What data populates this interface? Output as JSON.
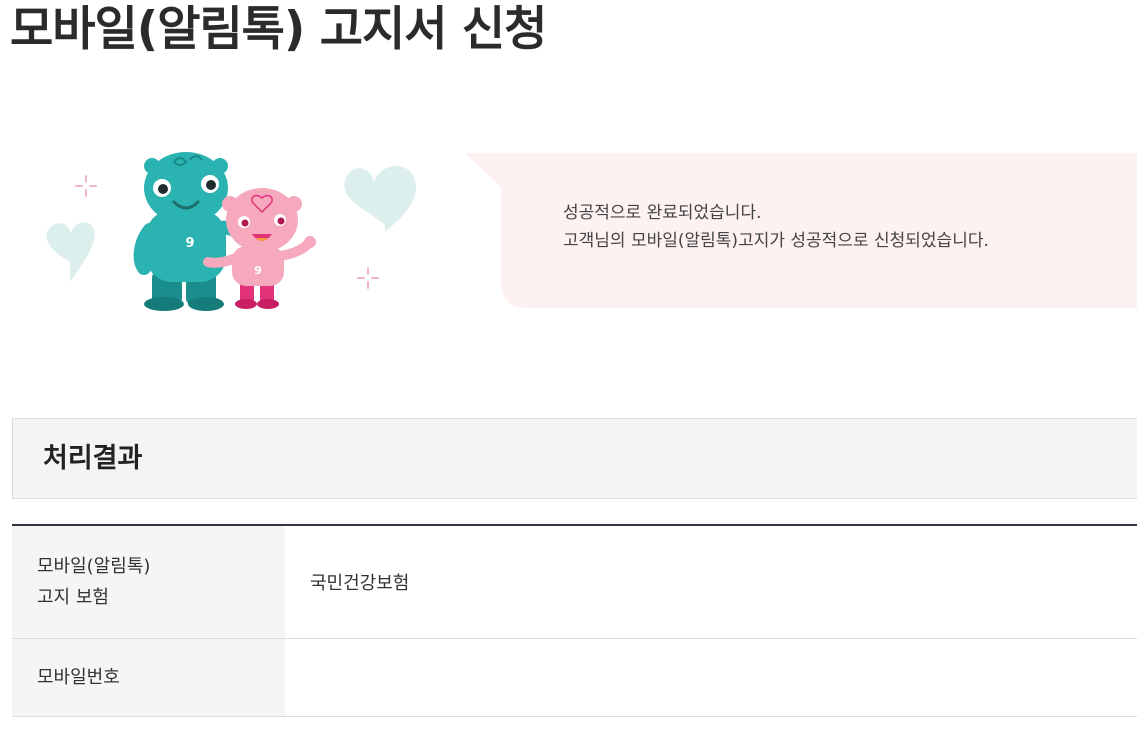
{
  "page": {
    "title": "모바일(알림톡) 고지서 신청"
  },
  "message": {
    "line1": "성공적으로 완료되었습니다.",
    "line2": "고객님의 모바일(알림톡)고지가 성공적으로 신청되었습니다."
  },
  "result": {
    "section_title": "처리결과",
    "rows": [
      {
        "label_line1": "모바일(알림톡)",
        "label_line2": "고지 보험",
        "value": "국민건강보험"
      },
      {
        "label_line1": "모바일번호",
        "value": ""
      }
    ]
  },
  "colors": {
    "bubble_bg": "#fdf1f1",
    "mascot_teal": "#2bb3b1",
    "mascot_pink": "#f6a9bd",
    "heart_mint": "#dcefec",
    "table_top_border": "#333344"
  },
  "illustration": {
    "elements": [
      "teal-mascot",
      "pink-mascot",
      "heart-icon",
      "sparkle-icon"
    ]
  }
}
